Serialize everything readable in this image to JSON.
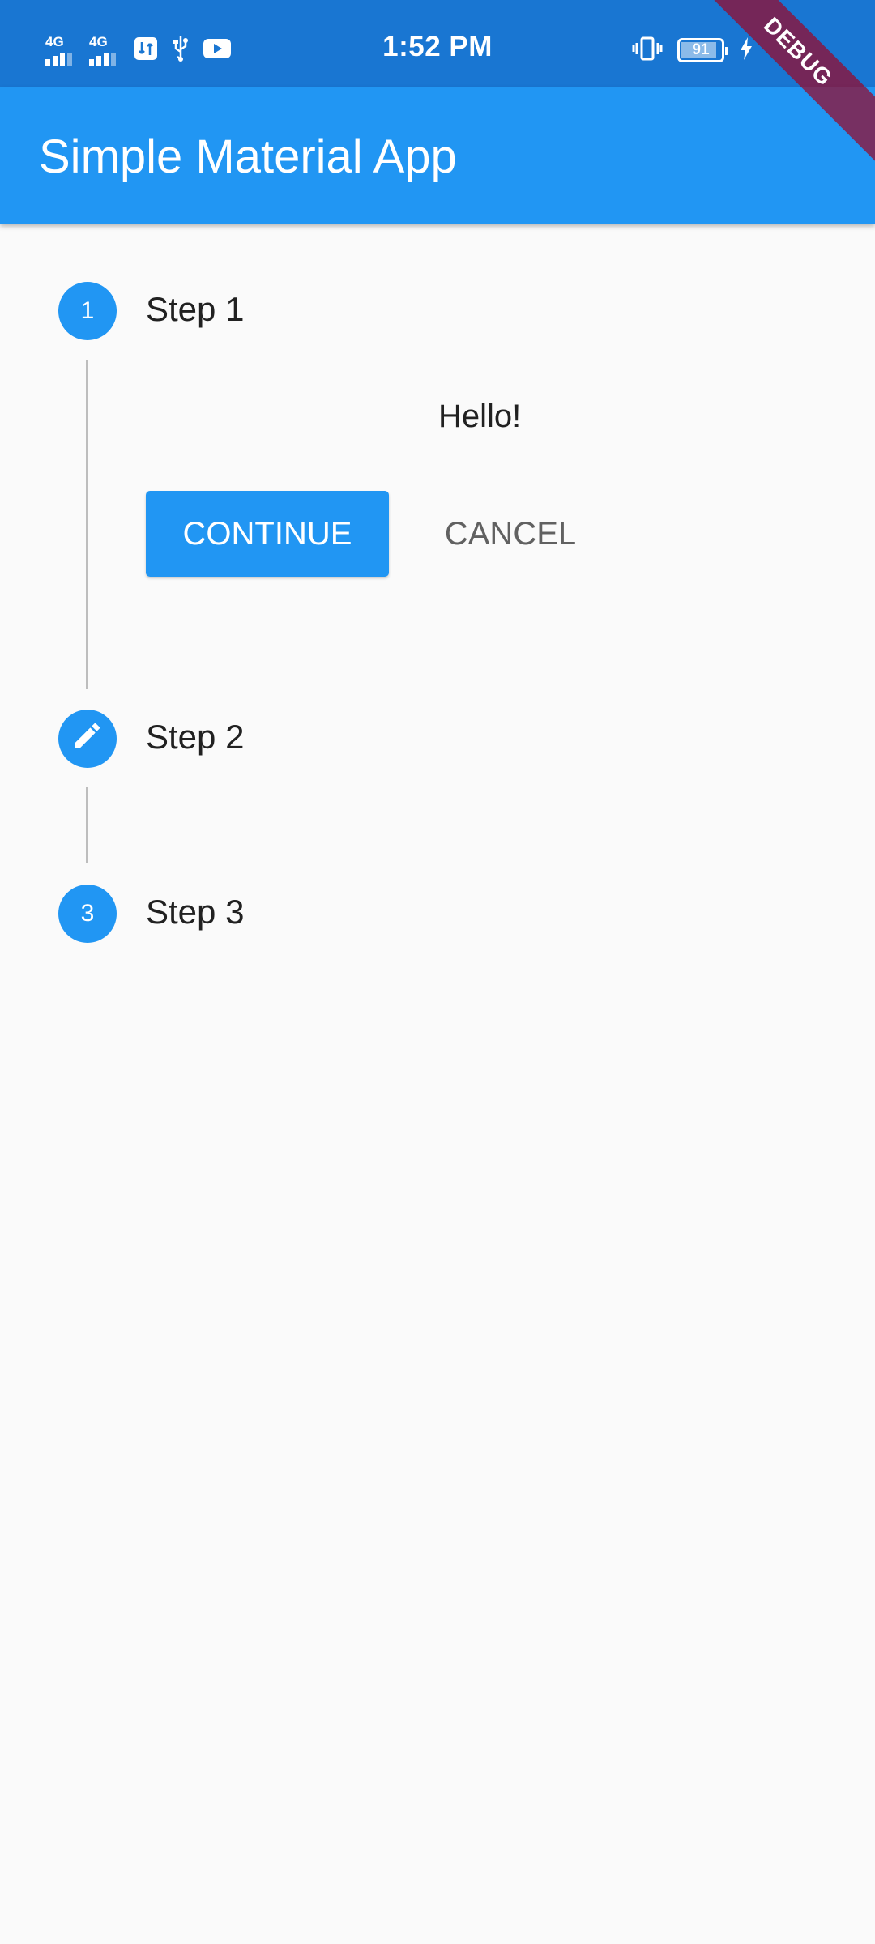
{
  "status_bar": {
    "time": "1:52 PM",
    "network_1": "4G",
    "network_2": "4G",
    "battery_level": 91,
    "battery_text": "91",
    "icons": [
      "signal-4g-icon",
      "signal-4g-icon",
      "file-transfer-icon",
      "usb-icon",
      "youtube-icon",
      "vibrate-icon",
      "battery-icon",
      "charging-icon"
    ]
  },
  "debug_banner": "DEBUG",
  "app_bar": {
    "title": "Simple Material App"
  },
  "stepper": {
    "steps": [
      {
        "number": "1",
        "title": "Step 1",
        "state": "active"
      },
      {
        "number": "2",
        "title": "Step 2",
        "state": "editing",
        "icon": "pencil-icon"
      },
      {
        "number": "3",
        "title": "Step 3",
        "state": "indexed"
      }
    ],
    "active_content": {
      "text": "Hello!",
      "continue_label": "CONTINUE",
      "cancel_label": "CANCEL"
    }
  },
  "colors": {
    "status_bar": "#1976d2",
    "app_bar": "#2196f3",
    "accent": "#2196f3",
    "background": "#fafafa",
    "connector": "#bdbdbd"
  }
}
